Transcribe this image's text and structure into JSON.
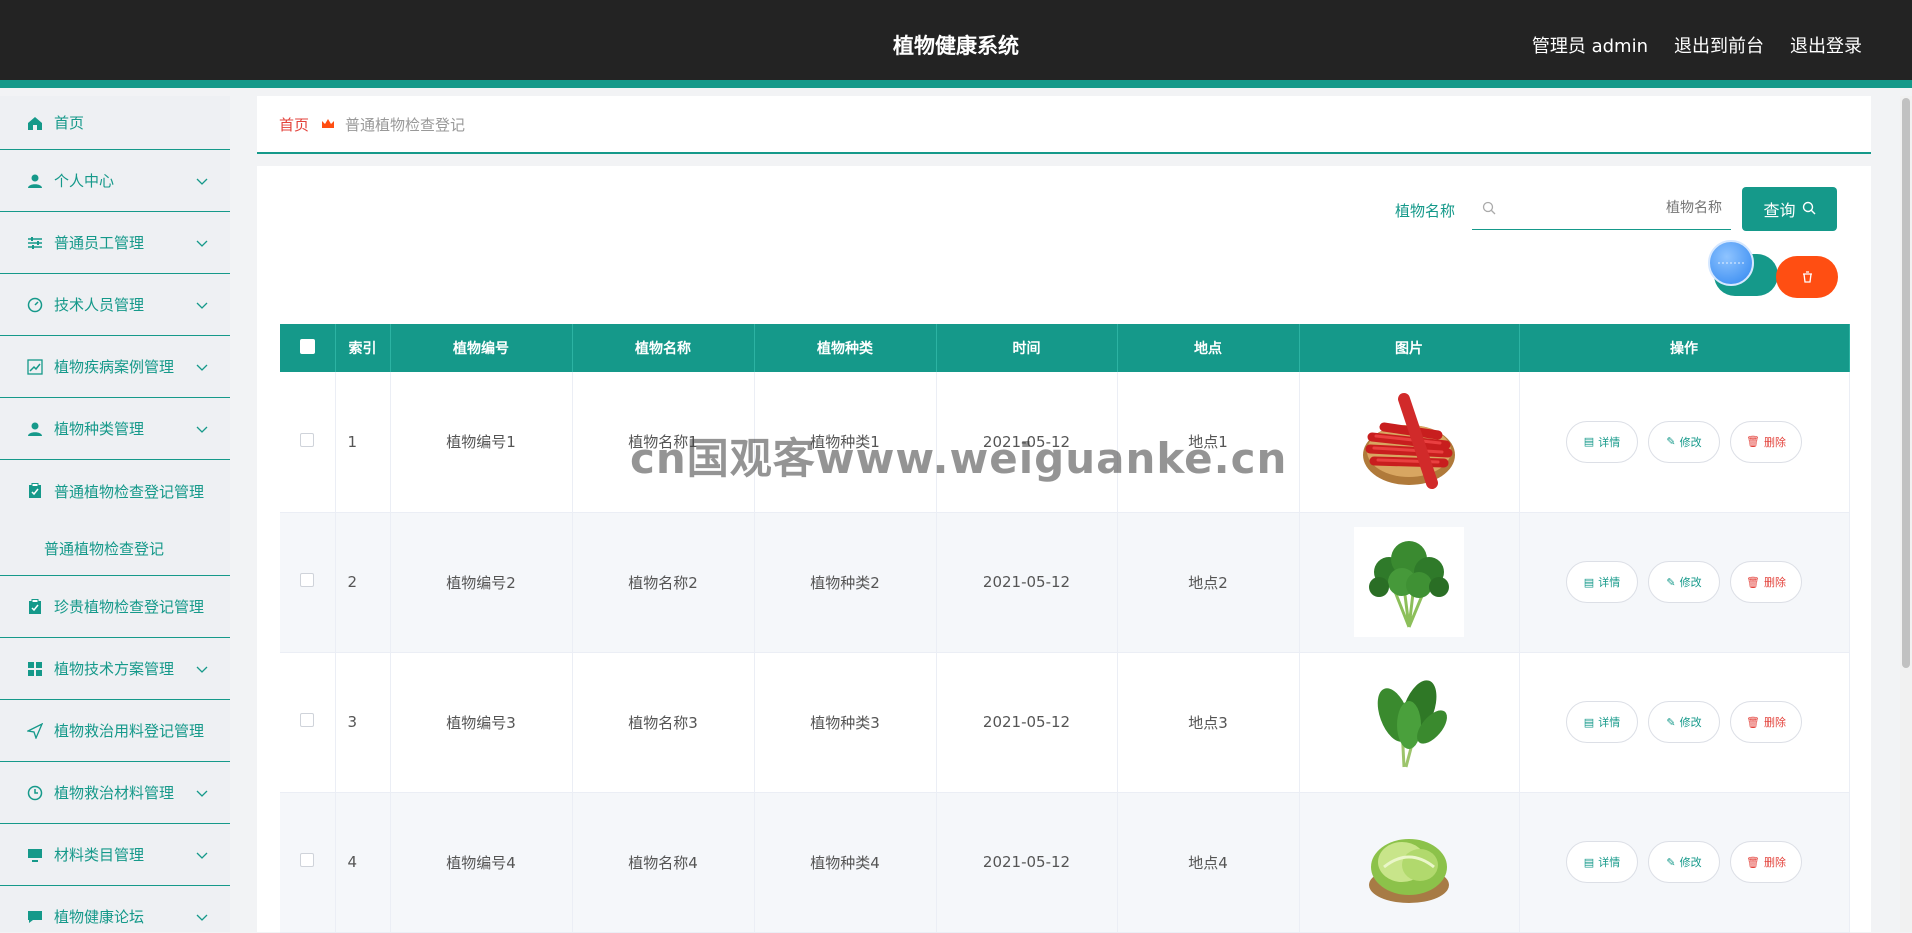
{
  "header": {
    "title": "植物健康系统",
    "user_label": "管理员 admin",
    "front_label": "退出到前台",
    "logout_label": "退出登录"
  },
  "sidebar": {
    "items": [
      {
        "label": "首页",
        "icon": "home-icon"
      },
      {
        "label": "个人中心",
        "icon": "user-icon"
      },
      {
        "label": "普通员工管理",
        "icon": "sliders-icon"
      },
      {
        "label": "技术人员管理",
        "icon": "gauge-icon"
      },
      {
        "label": "植物疾病案例管理",
        "icon": "chart-icon"
      },
      {
        "label": "植物种类管理",
        "icon": "user-icon"
      },
      {
        "label": "普通植物检查登记管理",
        "icon": "clipboard-icon",
        "sub": "普通植物检查登记"
      },
      {
        "label": "珍贵植物检查登记管理",
        "icon": "clipboard-icon"
      },
      {
        "label": "植物技术方案管理",
        "icon": "grid-icon"
      },
      {
        "label": "植物救治用料登记管理",
        "icon": "send-icon"
      },
      {
        "label": "植物救治材料管理",
        "icon": "clock-icon"
      },
      {
        "label": "材料类目管理",
        "icon": "monitor-icon"
      },
      {
        "label": "植物健康论坛",
        "icon": "chat-icon"
      }
    ]
  },
  "breadcrumb": {
    "home": "首页",
    "current": "普通植物检查登记"
  },
  "search": {
    "label": "植物名称",
    "placeholder": "植物名称",
    "button": "查询"
  },
  "table": {
    "headers": [
      "索引",
      "植物编号",
      "植物名称",
      "植物种类",
      "时间",
      "地点",
      "图片",
      "操作"
    ],
    "rows": [
      {
        "idx": "1",
        "code": "植物编号1",
        "name": "植物名称1",
        "kind": "植物种类1",
        "date": "2021-05-12",
        "place": "地点1",
        "img": "carrot"
      },
      {
        "idx": "2",
        "code": "植物编号2",
        "name": "植物名称2",
        "kind": "植物种类2",
        "date": "2021-05-12",
        "place": "地点2",
        "img": "parsley"
      },
      {
        "idx": "3",
        "code": "植物编号3",
        "name": "植物名称3",
        "kind": "植物种类3",
        "date": "2021-05-12",
        "place": "地点3",
        "img": "spinach"
      },
      {
        "idx": "4",
        "code": "植物编号4",
        "name": "植物名称4",
        "kind": "植物种类4",
        "date": "2021-05-12",
        "place": "地点4",
        "img": "lettuce"
      }
    ],
    "actions": {
      "detail": "详情",
      "edit": "修改",
      "delete": "删除"
    }
  },
  "watermark": "cn国观客www.weiguanke.cn",
  "colors": {
    "accent": "#15998a",
    "danger": "#ff4e12",
    "topbar": "#232323",
    "crumb_home": "#e3423b"
  }
}
